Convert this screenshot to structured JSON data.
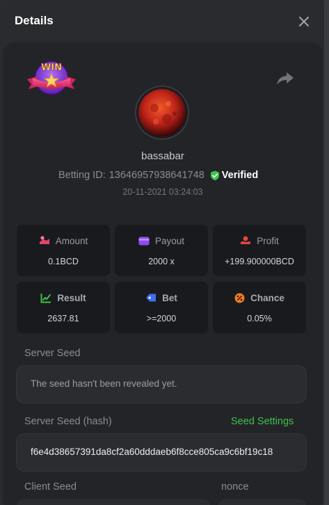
{
  "modal": {
    "title": "Details"
  },
  "player": {
    "username": "bassabar",
    "betting_id_label": "Betting ID:",
    "betting_id": "13646957938641748",
    "verified_label": "Verified",
    "datetime": "20-11-2021 03:24:03"
  },
  "badge": {
    "text": "WIN"
  },
  "stats": {
    "amount": {
      "label": "Amount",
      "value": "0.1BCD"
    },
    "payout": {
      "label": "Payout",
      "value": "2000 x"
    },
    "profit": {
      "label": "Profit",
      "value": "+199.900000BCD"
    },
    "result": {
      "label": "Result",
      "value": "2637.81"
    },
    "bet": {
      "label": "Bet",
      "value": ">=2000"
    },
    "chance": {
      "label": "Chance",
      "value": "0.05%"
    }
  },
  "seeds": {
    "server_seed_label": "Server Seed",
    "server_seed_value": "The seed hasn't been revealed yet.",
    "server_seed_hash_label": "Server Seed (hash)",
    "seed_settings_link": "Seed Settings",
    "server_seed_hash_value": "f6e4d38657391da8cf2a60dddaeb6f8cce805ca9c6bf19c18",
    "client_seed_label": "Client Seed",
    "nonce_label": "nonce"
  },
  "colors": {
    "panel_bg": "#232428",
    "card_bg": "#191a1d",
    "accent_green": "#3dc24c",
    "amount_icon": "#e0466a",
    "payout_icon": "#8a4df5",
    "profit_icon": "#e8453c",
    "result_icon": "#3dc24c",
    "bet_icon": "#3d6df0",
    "chance_icon": "#f07a1a"
  },
  "icons": {
    "close": "close-icon",
    "share": "share-icon",
    "verified": "shield-check-icon",
    "amount": "coin-hand-icon",
    "payout": "wallet-icon",
    "profit": "hand-coin-icon",
    "result": "chart-check-icon",
    "bet": "tag-icon",
    "chance": "percent-icon"
  }
}
